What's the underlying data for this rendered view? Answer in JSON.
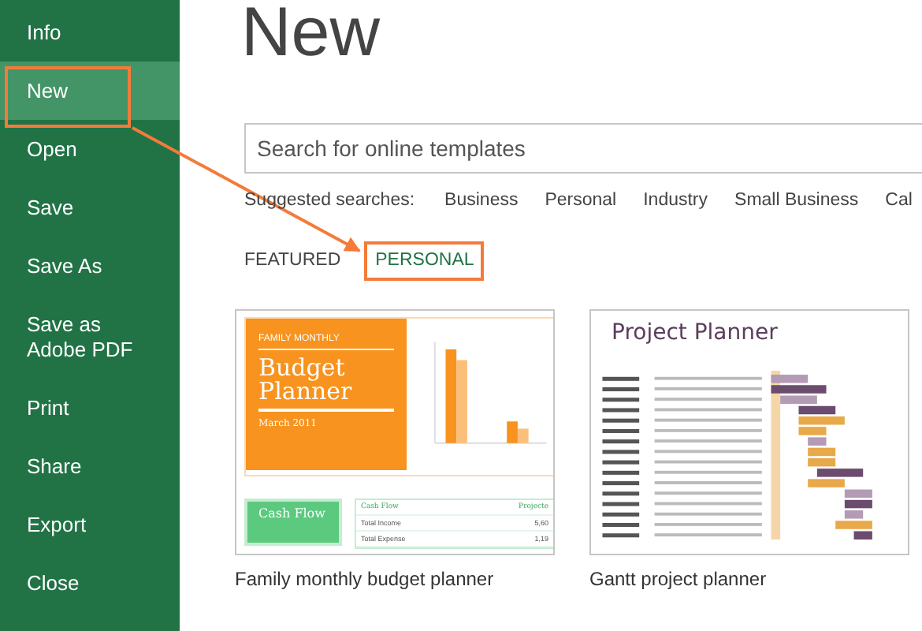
{
  "sidebar": {
    "items": [
      {
        "label": "Info",
        "selected": false
      },
      {
        "label": "New",
        "selected": true
      },
      {
        "label": "Open",
        "selected": false
      },
      {
        "label": "Save",
        "selected": false
      },
      {
        "label": "Save As",
        "selected": false
      },
      {
        "label": "Save as Adobe PDF",
        "selected": false
      },
      {
        "label": "Print",
        "selected": false
      },
      {
        "label": "Share",
        "selected": false
      },
      {
        "label": "Export",
        "selected": false
      },
      {
        "label": "Close",
        "selected": false
      }
    ]
  },
  "page_title": "New",
  "search": {
    "placeholder": "Search for online templates"
  },
  "suggested": {
    "label": "Suggested searches:",
    "items": [
      "Business",
      "Personal",
      "Industry",
      "Small Business",
      "Cal"
    ]
  },
  "tabs": [
    {
      "label": "FEATURED",
      "selected": false
    },
    {
      "label": "PERSONAL",
      "selected": true
    }
  ],
  "templates": [
    {
      "kind": "budget",
      "caption": "Family monthly budget planner",
      "overline": "FAMILY MONTHLY",
      "title": "Budget Planner",
      "date": "March 2011",
      "section": "Cash Flow",
      "table_header": [
        "Cash Flow",
        "Projecte"
      ],
      "table_rows": [
        [
          "Total Income",
          "5,60"
        ],
        [
          "Total Expense",
          "1,19"
        ]
      ]
    },
    {
      "kind": "gantt",
      "caption": "Gantt project planner",
      "title": "Project Planner"
    }
  ]
}
